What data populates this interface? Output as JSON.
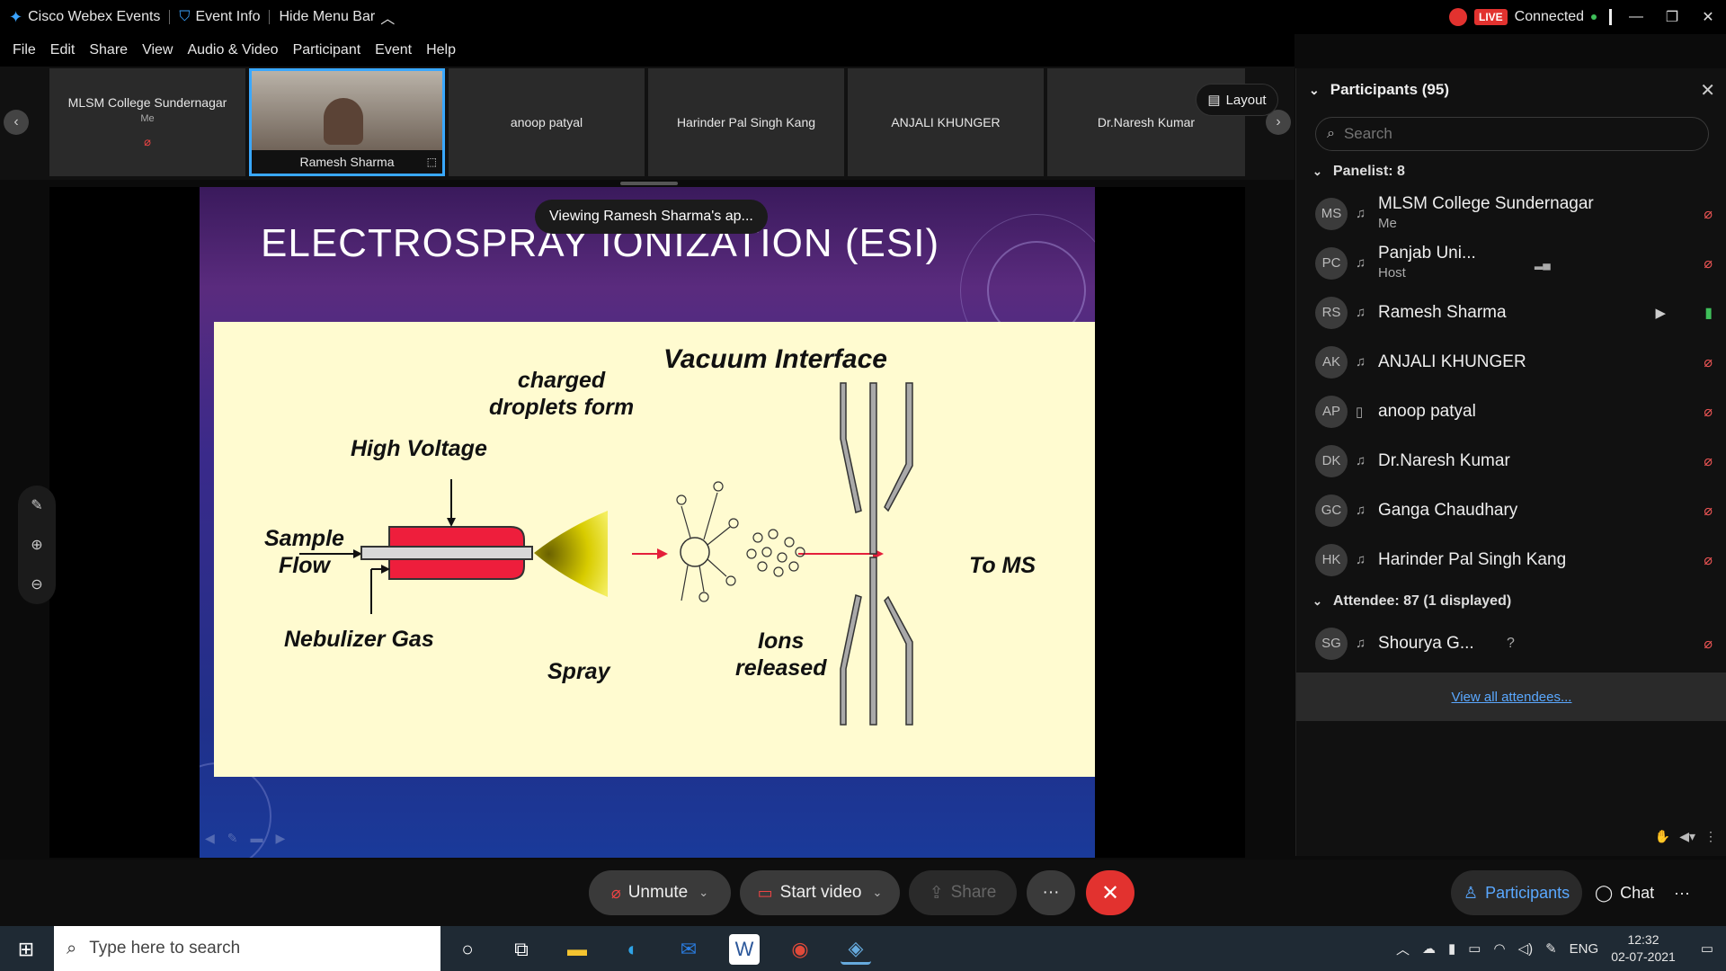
{
  "window": {
    "app_name": "Cisco Webex Events",
    "event_info": "Event Info",
    "hide_menu_bar": "Hide Menu Bar",
    "live_badge": "LIVE",
    "connection_status": "Connected"
  },
  "menu": [
    "File",
    "Edit",
    "Share",
    "View",
    "Audio & Video",
    "Participant",
    "Event",
    "Help"
  ],
  "filmstrip": {
    "tiles": [
      {
        "name": "MLSM College Sundernagar",
        "sub": "Me"
      },
      {
        "name": "Ramesh Sharma",
        "sub": ""
      },
      {
        "name": "anoop patyal",
        "sub": ""
      },
      {
        "name": "Harinder Pal Singh Kang",
        "sub": ""
      },
      {
        "name": "ANJALI KHUNGER",
        "sub": ""
      },
      {
        "name": "Dr.Naresh Kumar",
        "sub": ""
      }
    ],
    "layout_label": "Layout"
  },
  "stage": {
    "viewing_toast": "Viewing Ramesh Sharma's ap...",
    "slide": {
      "title": "ELECTROSPRAY IONIZATION (ESI)",
      "labels": {
        "vacuum_interface": "Vacuum Interface",
        "charged_droplets_1": "charged",
        "charged_droplets_2": "droplets form",
        "high_voltage": "High Voltage",
        "sample_1": "Sample",
        "sample_2": "Flow",
        "nebulizer_gas": "Nebulizer Gas",
        "spray": "Spray",
        "ions_1": "Ions",
        "ions_2": "released",
        "to_ms": "To MS"
      }
    }
  },
  "panel": {
    "title": "Participants (95)",
    "search_placeholder": "Search",
    "panelist_header": "Panelist: 8",
    "attendee_header": "Attendee: 87 (1 displayed)",
    "panelists": [
      {
        "initials": "MS",
        "name": "MLSM College Sundernagar",
        "role": "Me"
      },
      {
        "initials": "PC",
        "name": "Panjab Uni...",
        "role": "Host"
      },
      {
        "initials": "RS",
        "name": "Ramesh Sharma",
        "role": ""
      },
      {
        "initials": "AK",
        "name": "ANJALI KHUNGER",
        "role": ""
      },
      {
        "initials": "AP",
        "name": "anoop patyal",
        "role": ""
      },
      {
        "initials": "DK",
        "name": "Dr.Naresh Kumar",
        "role": ""
      },
      {
        "initials": "GC",
        "name": "Ganga Chaudhary",
        "role": ""
      },
      {
        "initials": "HK",
        "name": "Harinder Pal Singh Kang",
        "role": ""
      }
    ],
    "attendees": [
      {
        "initials": "SG",
        "name": "Shourya G...",
        "role": "",
        "status": "?"
      }
    ],
    "view_all": "View all attendees..."
  },
  "controls": {
    "unmute": "Unmute",
    "start_video": "Start video",
    "share": "Share",
    "more": "···",
    "participants_tab": "Participants",
    "chat_tab": "Chat"
  },
  "taskbar": {
    "search_placeholder": "Type here to search",
    "language": "ENG",
    "time": "12:32",
    "date": "02-07-2021"
  },
  "colors": {
    "accent": "#5aa8ff",
    "end_button": "#e2322f",
    "live_red": "#e2322f",
    "connected_green": "#3fbf5a"
  }
}
